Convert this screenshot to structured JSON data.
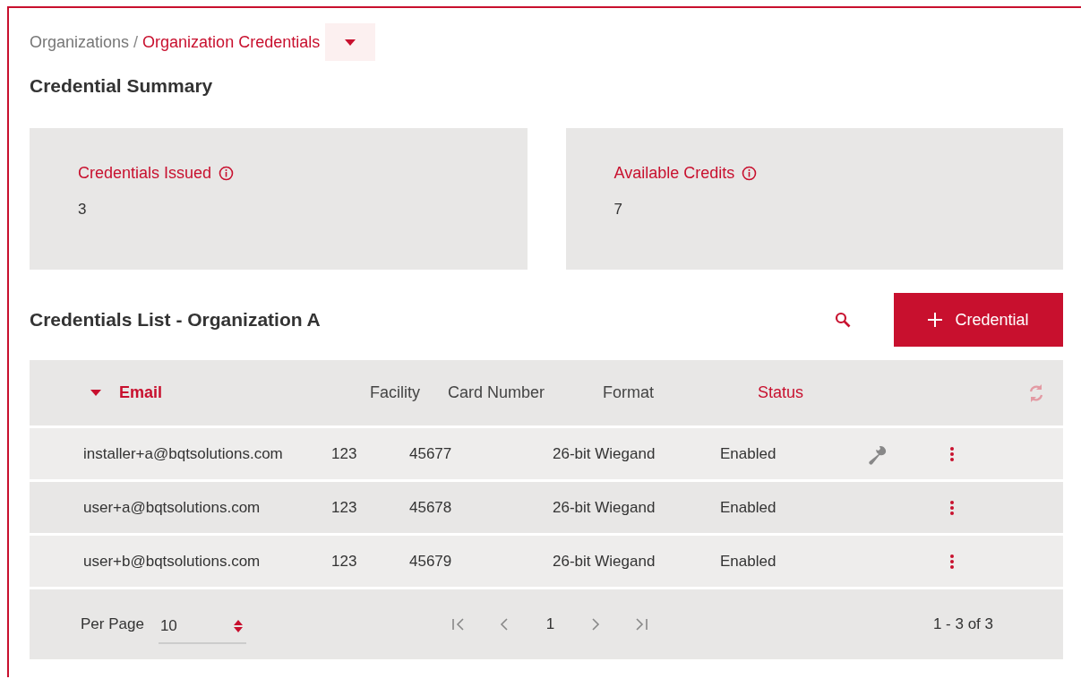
{
  "breadcrumb_separator": "/",
  "breadcrumb": [
    {
      "label": "Organizations",
      "current": false
    },
    {
      "label": "Organization Credentials",
      "current": true
    }
  ],
  "summary": {
    "title": "Credential Summary",
    "cards": [
      {
        "label": "Credentials Issued",
        "value": "3"
      },
      {
        "label": "Available Credits",
        "value": "7"
      }
    ]
  },
  "list": {
    "title": "Credentials List - Organization A",
    "add_button": "Credential"
  },
  "table": {
    "columns": [
      {
        "label": "Email",
        "sorted": true,
        "sortable": true
      },
      {
        "label": "Facility",
        "sorted": false,
        "sortable": false
      },
      {
        "label": "Card Number",
        "sorted": false,
        "sortable": false
      },
      {
        "label": "Format",
        "sorted": false,
        "sortable": false
      },
      {
        "label": "Status",
        "sorted": false,
        "sortable": true
      }
    ],
    "rows": [
      {
        "email": "installer+a@bqtsolutions.com",
        "facility": "123",
        "card_number": "45677",
        "format": "26-bit Wiegand",
        "status": "Enabled",
        "tool": true
      },
      {
        "email": "user+a@bqtsolutions.com",
        "facility": "123",
        "card_number": "45678",
        "format": "26-bit Wiegand",
        "status": "Enabled",
        "tool": false
      },
      {
        "email": "user+b@bqtsolutions.com",
        "facility": "123",
        "card_number": "45679",
        "format": "26-bit Wiegand",
        "status": "Enabled",
        "tool": false
      }
    ]
  },
  "pagination": {
    "per_page_label": "Per Page",
    "per_page": "10",
    "page": "1",
    "range": "1 - 3 of 3"
  }
}
